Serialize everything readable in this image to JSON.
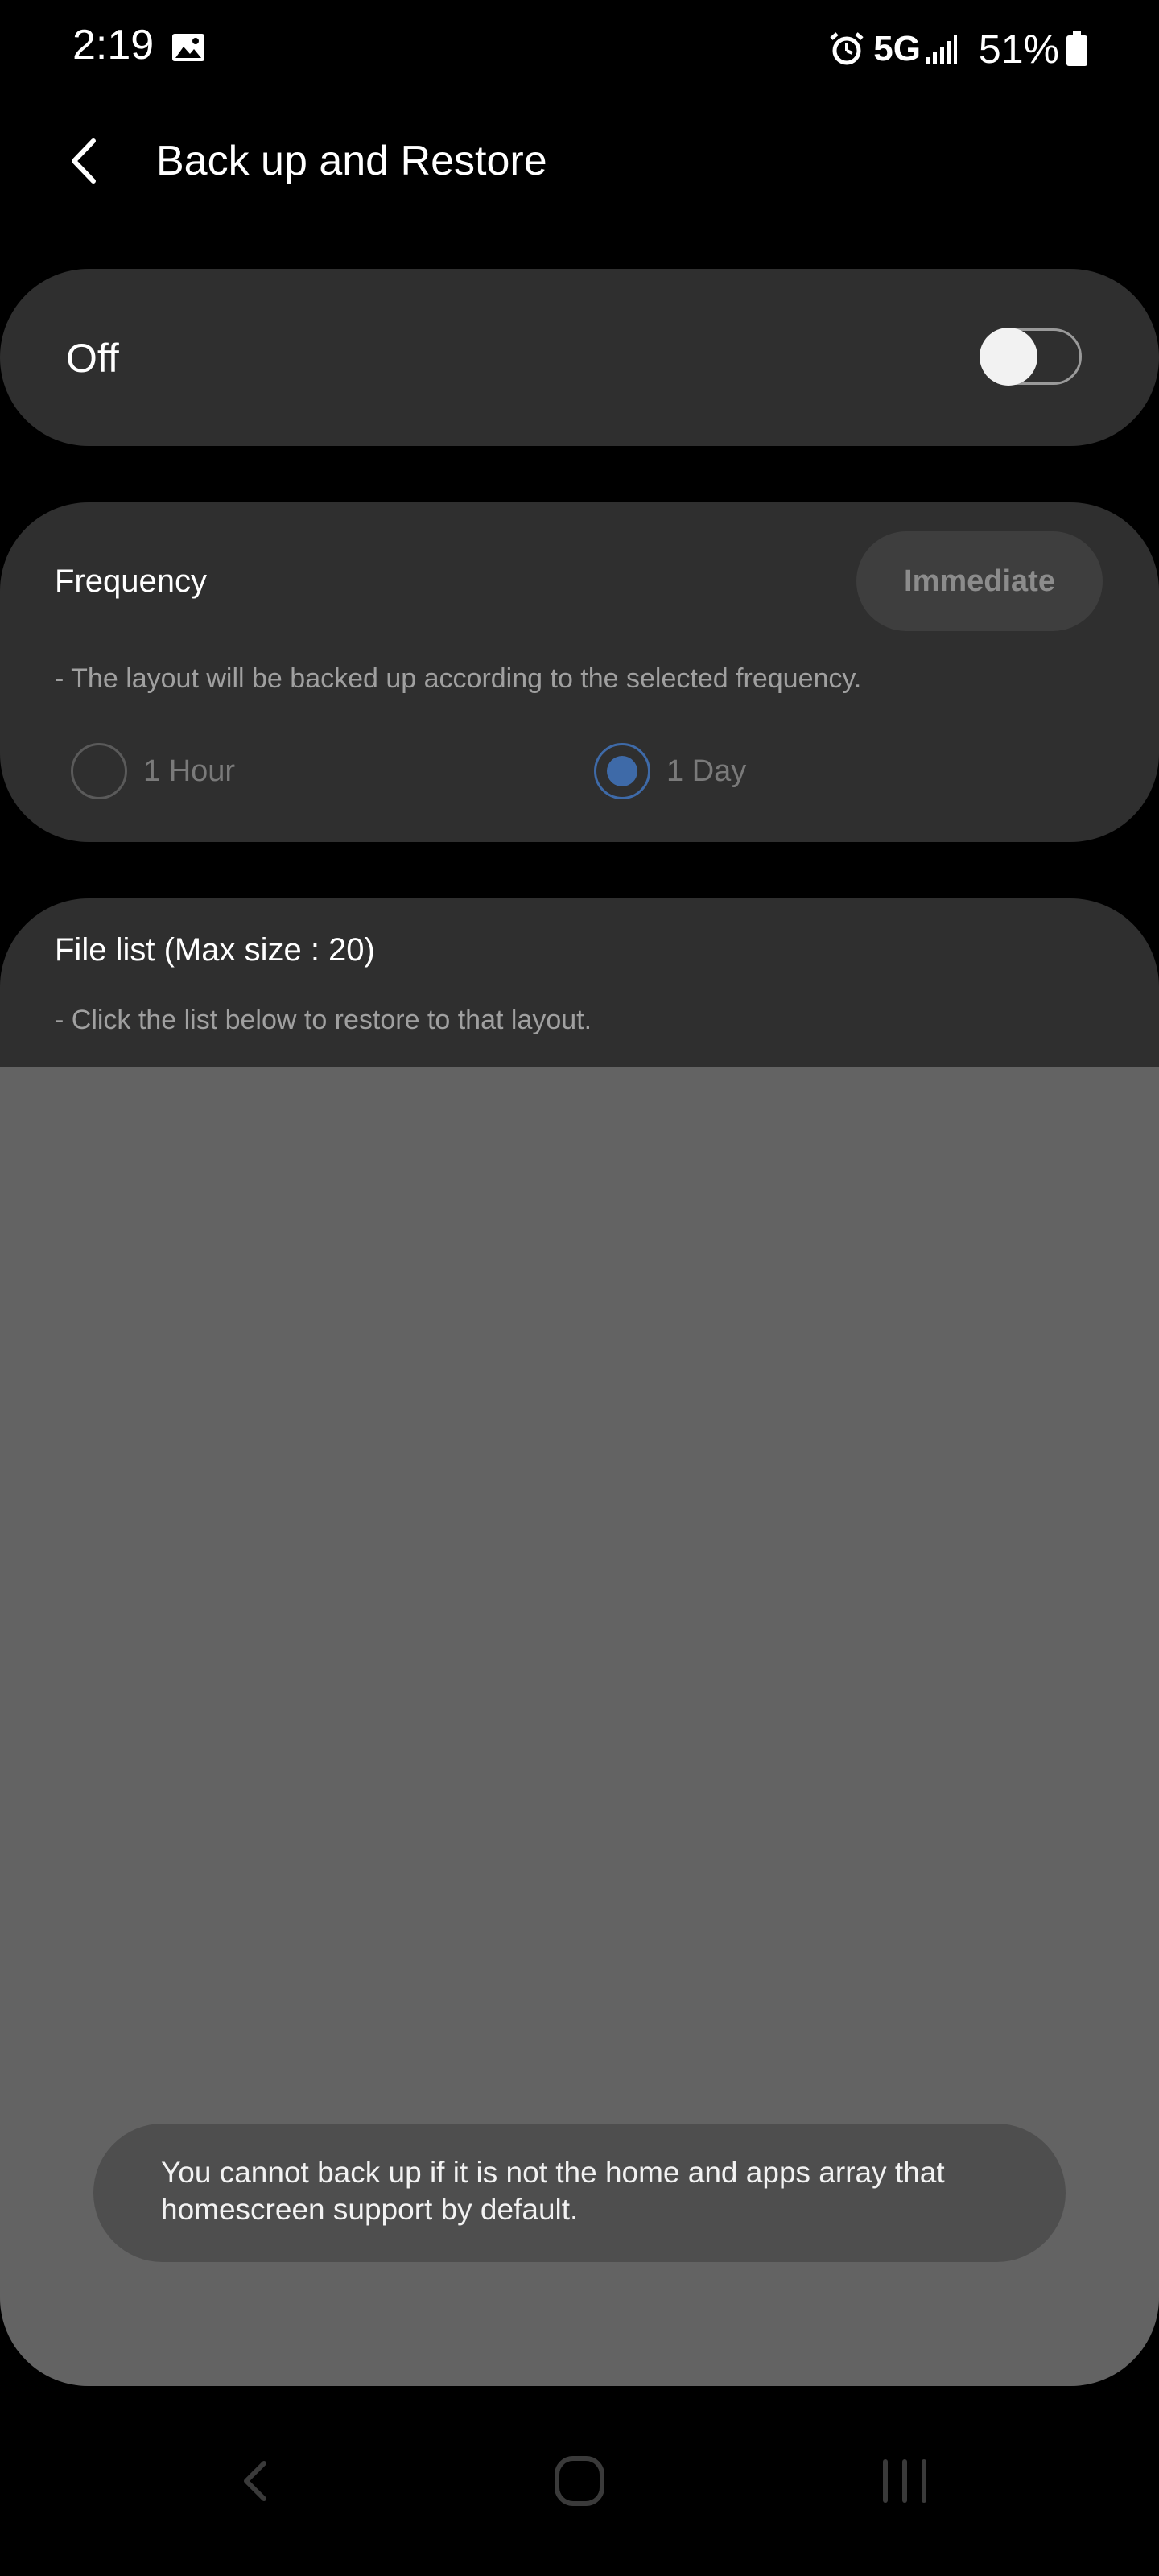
{
  "status_bar": {
    "time": "2:19",
    "network": "5G",
    "battery": "51%",
    "icons": [
      "gallery-icon",
      "alarm-icon",
      "signal-icon",
      "battery-icon"
    ]
  },
  "header": {
    "title": "Back up and Restore",
    "back_icon": "chevron-left-icon"
  },
  "backup_switch": {
    "label": "Off",
    "enabled": false
  },
  "frequency": {
    "title": "Frequency",
    "immediate_button": "Immediate",
    "description": "- The layout will be backed up according to the selected frequency.",
    "options": [
      {
        "label": "1 Hour",
        "selected": false
      },
      {
        "label": "1 Day",
        "selected": true
      }
    ]
  },
  "file_list": {
    "title": "File list (Max size : 20)",
    "description": "- Click the list below to restore to that layout."
  },
  "toast": {
    "message": "You cannot back up if it is not the home and apps array that homescreen support by default."
  },
  "nav_bar": {
    "icons": [
      "back-icon",
      "home-icon",
      "recent-apps-icon"
    ]
  },
  "colors": {
    "background": "#000000",
    "card": "#2f2f2f",
    "overlay": "#636363",
    "accent": "#3e6aa8",
    "toast": "#4e4e4e"
  }
}
